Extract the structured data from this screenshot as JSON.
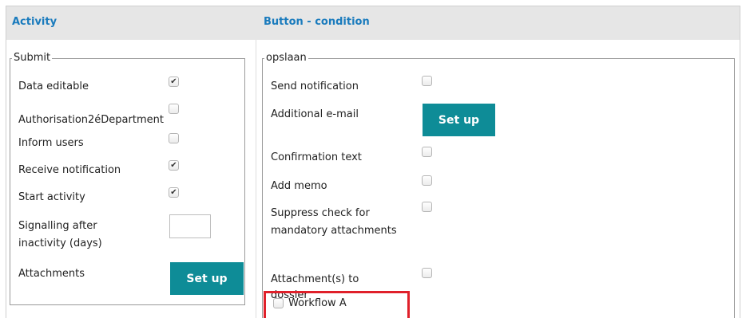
{
  "header": {
    "activity_title": "Activity",
    "button_condition_title": "Button - condition"
  },
  "submit_group": {
    "legend": "Submit",
    "data_editable": "Data editable",
    "authorisation": "Authorisation2éDepartment",
    "inform_users": "Inform users",
    "receive_notification": "Receive notification",
    "start_activity": "Start activity",
    "signalling_line1": "Signalling after",
    "signalling_line2": "inactivity (days)",
    "signalling_value": "",
    "attachments": "Attachments",
    "setup_label": "Set up",
    "checks": {
      "data_editable": true,
      "authorisation": false,
      "inform_users": false,
      "receive_notification": true,
      "start_activity": true
    }
  },
  "opslaan_group": {
    "legend": "opslaan",
    "send_notification": "Send notification",
    "additional_email": "Additional e-mail",
    "setup_label": "Set up",
    "confirmation_text": "Confirmation text",
    "add_memo": "Add memo",
    "suppress_line1": "Suppress check for",
    "suppress_line2": "mandatory attachments",
    "attachments_to_line1": "Attachment(s) to",
    "attachments_to_line2": "dossier",
    "workflow_option": "Workflow A",
    "checks": {
      "send_notification": false,
      "confirmation_text": false,
      "add_memo": false,
      "suppress_check": false,
      "attachments_to_dossier": false,
      "workflow_a": false
    }
  },
  "icons": {
    "checked_glyph": "✔"
  },
  "colors": {
    "header_text": "#1a7bbd",
    "button_bg": "#0e8c97",
    "highlight": "#e0202a"
  }
}
